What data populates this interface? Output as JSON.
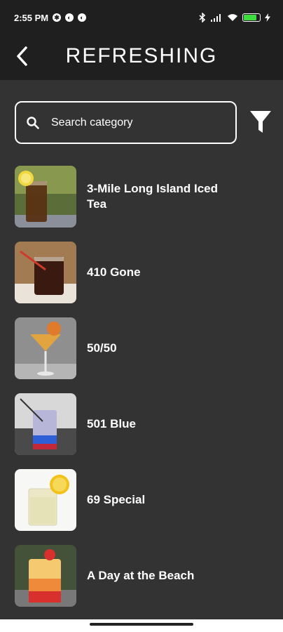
{
  "status_bar": {
    "time": "2:55 PM",
    "battery_level": 0.8,
    "battery_color": "#3fdc3f"
  },
  "header": {
    "title": "REFRESHING",
    "back_icon": "chevron-left-icon"
  },
  "search": {
    "placeholder": "Search category",
    "icon": "search-icon"
  },
  "filter": {
    "icon": "filter-funnel-icon"
  },
  "drinks": [
    {
      "name": "3-Mile Long Island Iced Tea",
      "image": "iced-tea-with-lemon"
    },
    {
      "name": "410 Gone",
      "image": "dark-cola-drink"
    },
    {
      "name": "50/50",
      "image": "martini-with-orange"
    },
    {
      "name": "501 Blue",
      "image": "blue-layered-drink"
    },
    {
      "name": "69 Special",
      "image": "lemonade-with-lemon"
    },
    {
      "name": "A Day at the Beach",
      "image": "sunset-layered-drink"
    }
  ],
  "colors": {
    "background": "#333333",
    "header": "#1f1f1f",
    "text": "#ffffff"
  }
}
